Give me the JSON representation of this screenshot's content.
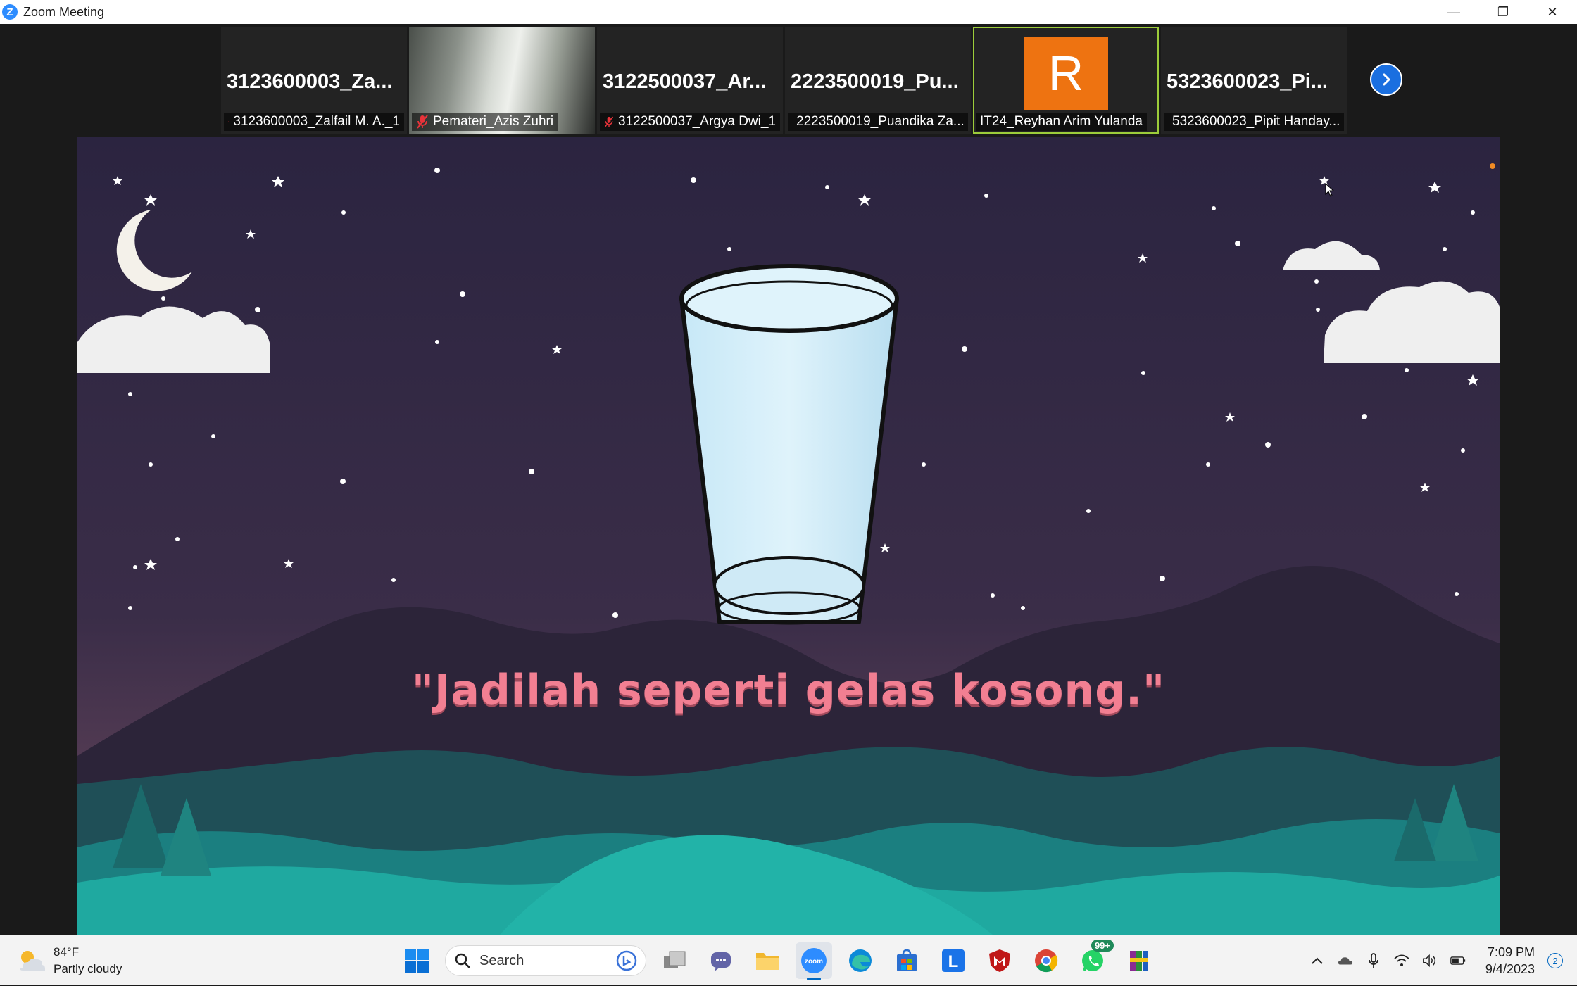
{
  "window": {
    "title": "Zoom Meeting",
    "app_icon_letter": "Z",
    "controls": {
      "minimize": "—",
      "restore": "❐",
      "close": "✕"
    }
  },
  "participants": [
    {
      "big_name": "3123600003_Za...",
      "label": "3123600003_Zalfail M. A._1",
      "muted": true,
      "kind": "name"
    },
    {
      "big_name": "",
      "label": "Pemateri_Azis Zuhri",
      "muted": true,
      "kind": "video"
    },
    {
      "big_name": "3122500037_Ar...",
      "label": "3122500037_Argya Dwi_1",
      "muted": true,
      "kind": "name"
    },
    {
      "big_name": "2223500019_Pu...",
      "label": "2223500019_Puandika Za...",
      "muted": true,
      "kind": "name"
    },
    {
      "big_name": "",
      "label": "IT24_Reyhan Arim Yulanda",
      "muted": false,
      "kind": "avatar",
      "avatar_letter": "R"
    },
    {
      "big_name": "5323600023_Pi...",
      "label": "5323600023_Pipit Handay...",
      "muted": true,
      "kind": "name"
    }
  ],
  "slide": {
    "quote": "\"Jadilah seperti gelas kosong.\""
  },
  "colors": {
    "zoom_blue": "#2D8CFF",
    "active_speaker": "#9ccc3a",
    "avatar_orange": "#EE7311",
    "quote_pink": "#f27f92",
    "sky_top": "#2b2440",
    "sky_bottom": "#5a3f56",
    "hill_teal": "#1fa9a0"
  },
  "taskbar": {
    "weather": {
      "temp": "84°F",
      "desc": "Partly cloudy",
      "icon": "partly-cloudy-icon"
    },
    "search_placeholder": "Search",
    "apps": [
      {
        "name": "task-view-icon",
        "active": false
      },
      {
        "name": "teams-chat-icon",
        "active": false
      },
      {
        "name": "file-explorer-icon",
        "active": false
      },
      {
        "name": "zoom-icon",
        "active": true,
        "text": "zoom"
      },
      {
        "name": "edge-icon",
        "active": false
      },
      {
        "name": "store-icon",
        "active": false
      },
      {
        "name": "l-app-icon",
        "active": false,
        "text": "L"
      },
      {
        "name": "mcafee-icon",
        "active": false
      },
      {
        "name": "chrome-icon",
        "active": false
      },
      {
        "name": "whatsapp-icon",
        "active": false,
        "badge": "99+"
      },
      {
        "name": "winrar-icon",
        "active": false
      }
    ],
    "time": "7:09 PM",
    "date": "9/4/2023",
    "notifications": "2"
  }
}
